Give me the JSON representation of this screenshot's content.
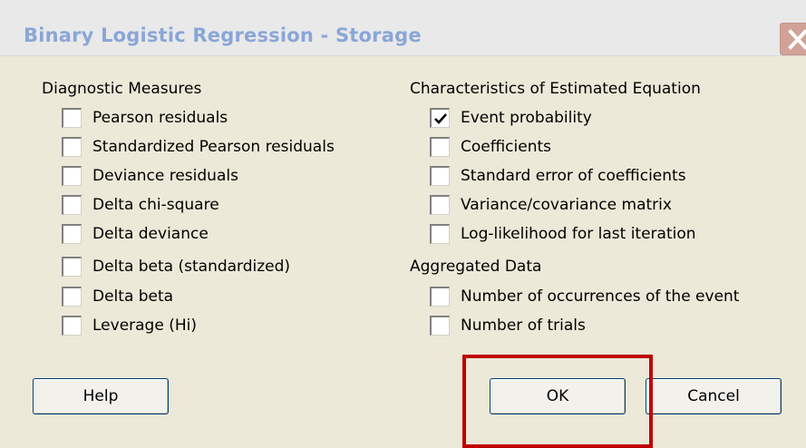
{
  "window": {
    "title": "Binary Logistic Regression - Storage",
    "close_icon": "close-icon"
  },
  "diagnostic": {
    "heading": "Diagnostic Measures",
    "items": [
      {
        "label": "Pearson residuals",
        "checked": false
      },
      {
        "label": "Standardized Pearson residuals",
        "checked": false
      },
      {
        "label": "Deviance residuals",
        "checked": false
      },
      {
        "label": "Delta chi-square",
        "checked": false
      },
      {
        "label": "Delta deviance",
        "checked": false
      },
      {
        "label": "Delta beta (standardized)",
        "checked": false
      },
      {
        "label": "Delta beta",
        "checked": false
      },
      {
        "label": "Leverage (Hi)",
        "checked": false
      }
    ]
  },
  "characteristics": {
    "heading": "Characteristics of Estimated Equation",
    "items": [
      {
        "label": "Event probability",
        "checked": true
      },
      {
        "label": "Coefficients",
        "checked": false
      },
      {
        "label": "Standard error of coefficients",
        "checked": false
      },
      {
        "label": "Variance/covariance matrix",
        "checked": false
      },
      {
        "label": "Log-likelihood for last iteration",
        "checked": false
      }
    ]
  },
  "aggregated": {
    "heading": "Aggregated Data",
    "items": [
      {
        "label": "Number of occurrences of the event",
        "checked": false
      },
      {
        "label": "Number of trials",
        "checked": false
      }
    ]
  },
  "buttons": {
    "help": "Help",
    "ok": "OK",
    "cancel": "Cancel"
  },
  "colors": {
    "highlight": "#c00000",
    "title_text": "#8aa6d6",
    "dialog_bg": "#ece9d8"
  }
}
